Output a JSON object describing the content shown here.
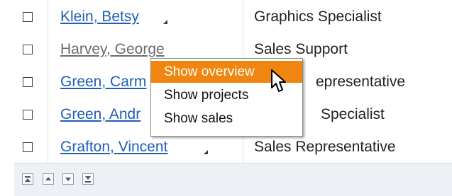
{
  "rows": [
    {
      "name": "Klein, Betsy",
      "role": "Graphics Specialist",
      "name_state": "link"
    },
    {
      "name": "Harvey, George",
      "role": "Sales Support",
      "name_state": "visited"
    },
    {
      "name": "Green, Carm",
      "role": "epresentative",
      "name_state": "link"
    },
    {
      "name": "Green, Andr",
      "role": "Specialist",
      "name_state": "link"
    },
    {
      "name": "Grafton, Vincent",
      "role": "Sales Representative",
      "name_state": "link"
    }
  ],
  "context_menu": {
    "items": [
      {
        "label": "Show overview",
        "highlighted": true
      },
      {
        "label": "Show projects",
        "highlighted": false
      },
      {
        "label": "Show sales",
        "highlighted": false
      }
    ],
    "highlight_color": "#f0860f"
  },
  "footer": {
    "buttons": [
      {
        "icon": "first-page-icon"
      },
      {
        "icon": "previous-page-icon"
      },
      {
        "icon": "next-page-icon"
      },
      {
        "icon": "last-page-icon"
      }
    ]
  },
  "colors": {
    "link": "#1f5fb4",
    "visited": "#6b6b6b",
    "grid_line": "#d9dfe7",
    "footer_bg": "#edf1f6"
  }
}
